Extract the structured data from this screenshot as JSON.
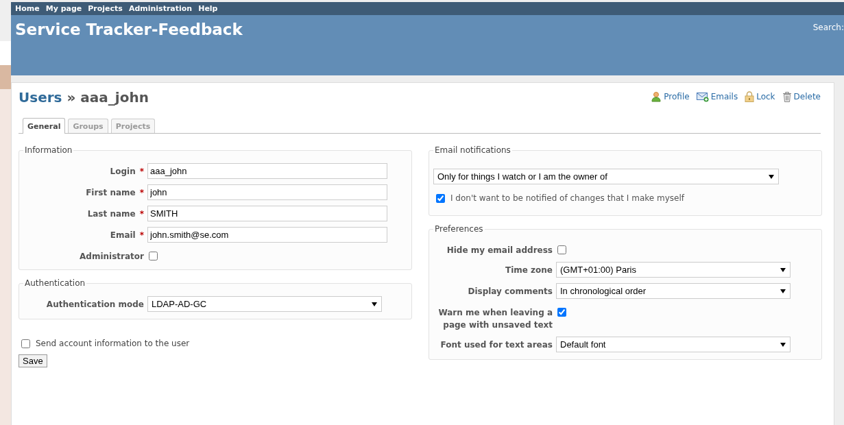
{
  "top_menu": [
    {
      "label": "Home"
    },
    {
      "label": "My page"
    },
    {
      "label": "Projects"
    },
    {
      "label": "Administration"
    },
    {
      "label": "Help"
    }
  ],
  "header": {
    "title": "Service Tracker-Feedback",
    "search_label": "Search:"
  },
  "breadcrumb": {
    "parent": "Users",
    "separator": "»",
    "current": "aaa_john"
  },
  "actions": [
    {
      "label": "Profile",
      "kind": "profile"
    },
    {
      "label": "Emails",
      "kind": "emails"
    },
    {
      "label": "Lock",
      "kind": "lock"
    },
    {
      "label": "Delete",
      "kind": "delete"
    }
  ],
  "tabs": [
    {
      "label": "General",
      "selected": true
    },
    {
      "label": "Groups",
      "selected": false
    },
    {
      "label": "Projects",
      "selected": false
    }
  ],
  "information": {
    "legend": "Information",
    "fields": [
      {
        "label": "Login",
        "required_mark": "*",
        "kind": "text",
        "value": "aaa_john"
      },
      {
        "label": "First name",
        "required_mark": "*",
        "kind": "text",
        "value": "john"
      },
      {
        "label": "Last name",
        "required_mark": "*",
        "kind": "text",
        "value": "SMITH"
      },
      {
        "label": "Email",
        "required_mark": "*",
        "kind": "text",
        "value": "john.smith@se.com"
      },
      {
        "label": "Administrator",
        "kind": "checkbox",
        "checked": false
      }
    ]
  },
  "authentication": {
    "legend": "Authentication",
    "fields": [
      {
        "label": "Authentication mode",
        "kind": "select",
        "value": "LDAP-AD-GC"
      }
    ]
  },
  "send_account_info": {
    "label": "Send account information to the user",
    "checked": false
  },
  "save_button": "Save",
  "email_notifications": {
    "legend": "Email notifications",
    "value": "Only for things I watch or I am the owner of",
    "no_self_notified": {
      "label": "I don't want to be notified of changes that I make myself",
      "checked": true
    }
  },
  "preferences": {
    "legend": "Preferences",
    "fields": [
      {
        "label": "Hide my email address",
        "kind": "checkbox",
        "checked": false
      },
      {
        "label": "Time zone",
        "kind": "select",
        "value": "(GMT+01:00) Paris"
      },
      {
        "label": "Display comments",
        "kind": "select",
        "value": "In chronological order"
      },
      {
        "label": "Warn me when leaving a page with unsaved text",
        "kind": "checkbox",
        "checked": true
      },
      {
        "label": "Font used for text areas",
        "kind": "select",
        "value": "Default font"
      }
    ]
  }
}
